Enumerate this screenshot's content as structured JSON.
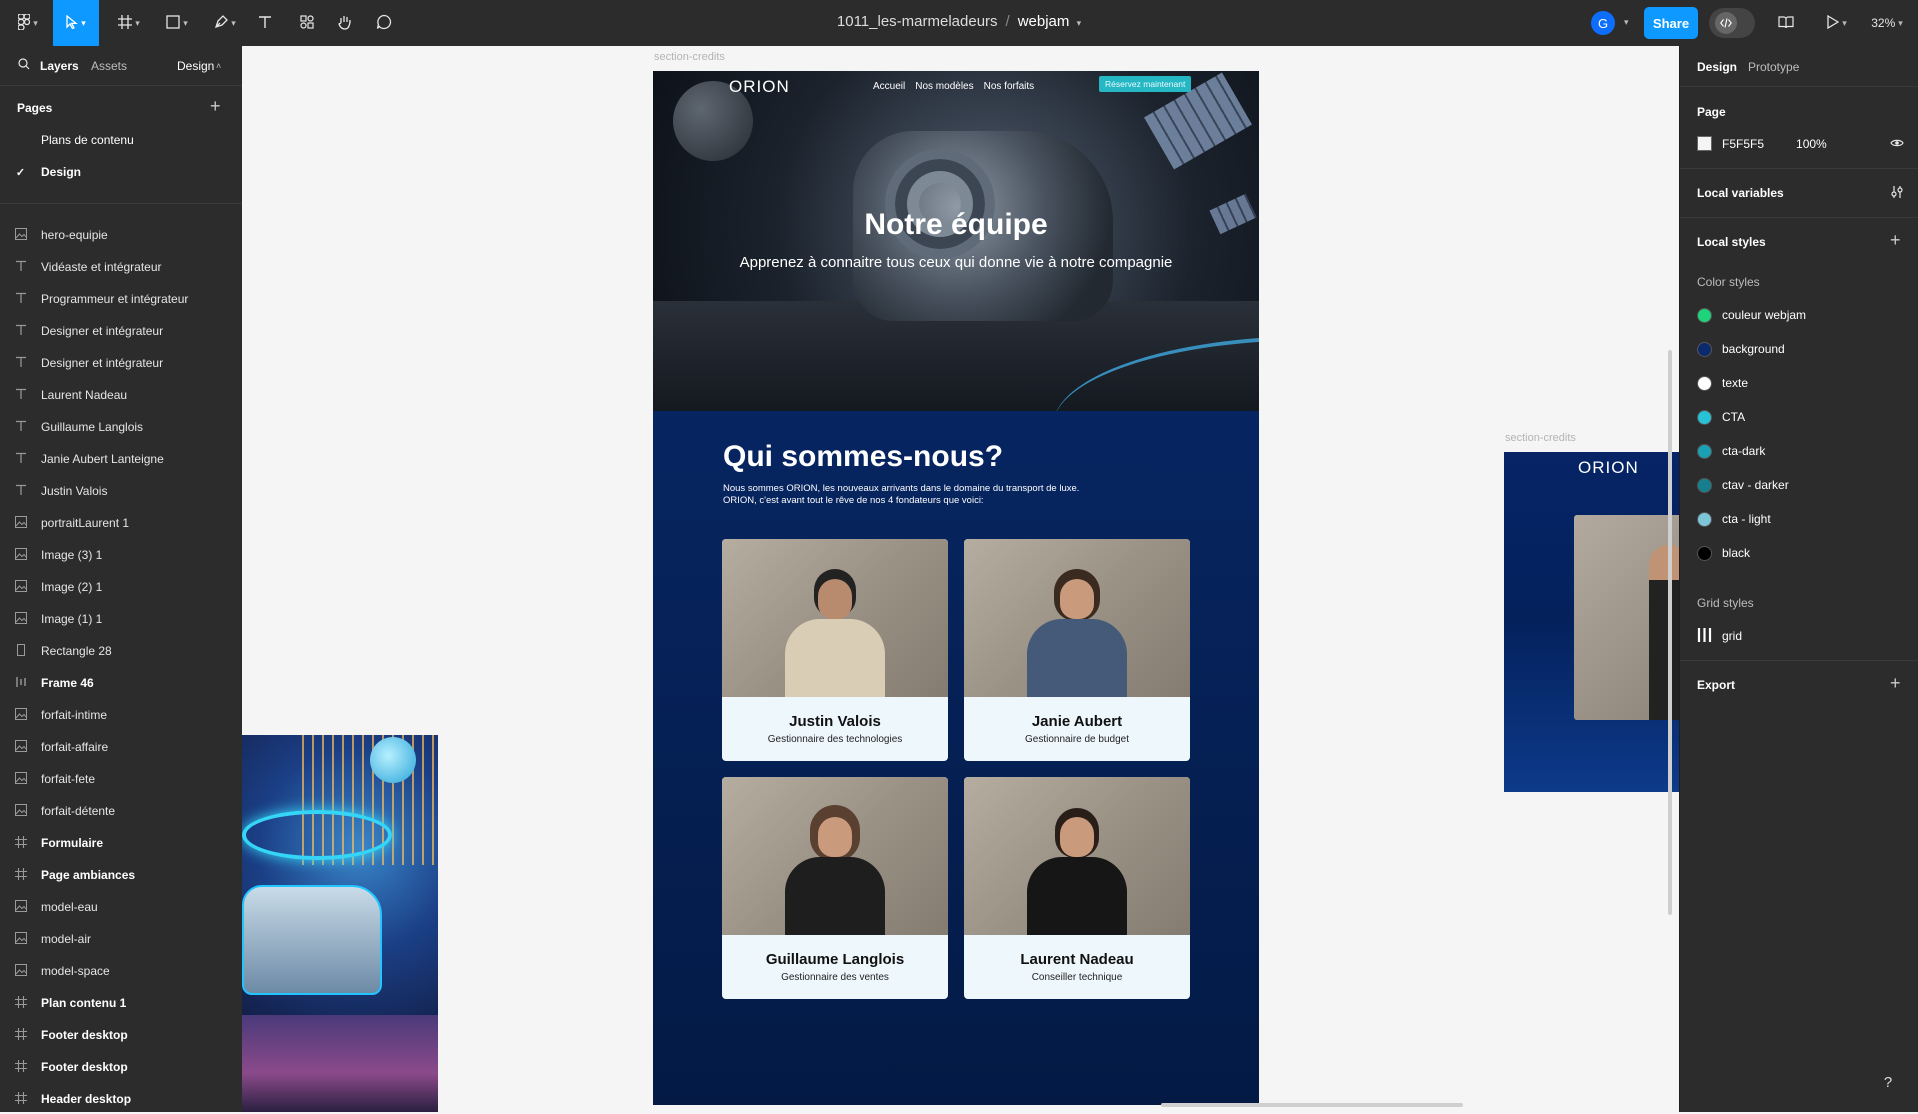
{
  "toolbar": {
    "file_name": "1011_les-marmeladeurs",
    "separator": "/",
    "project": "webjam",
    "avatar_initial": "G",
    "share_label": "Share",
    "zoom": "32%"
  },
  "left_panel": {
    "tabs": [
      "Layers",
      "Assets",
      "Design"
    ],
    "pages_heading": "Pages",
    "pages": [
      "Plans de contenu",
      "Design"
    ],
    "layers": [
      {
        "label": "hero-equipie",
        "type": "image"
      },
      {
        "label": "Vidéaste et intégrateur",
        "type": "text"
      },
      {
        "label": "Programmeur et intégrateur",
        "type": "text"
      },
      {
        "label": "Designer et intégrateur",
        "type": "text"
      },
      {
        "label": "Designer et intégrateur",
        "type": "text"
      },
      {
        "label": "Laurent Nadeau",
        "type": "text"
      },
      {
        "label": "Guillaume Langlois",
        "type": "text"
      },
      {
        "label": "Janie Aubert Lanteigne",
        "type": "text"
      },
      {
        "label": "Justin Valois",
        "type": "text"
      },
      {
        "label": "portraitLaurent 1",
        "type": "image"
      },
      {
        "label": "Image (3) 1",
        "type": "image"
      },
      {
        "label": "Image (2) 1",
        "type": "image"
      },
      {
        "label": "Image (1) 1",
        "type": "image"
      },
      {
        "label": "Rectangle 28",
        "type": "rect"
      },
      {
        "label": "Frame 46",
        "type": "autolayout"
      },
      {
        "label": "forfait-intime",
        "type": "image"
      },
      {
        "label": "forfait-affaire",
        "type": "image"
      },
      {
        "label": "forfait-fete",
        "type": "image"
      },
      {
        "label": "forfait-détente",
        "type": "image"
      },
      {
        "label": "Formulaire",
        "type": "frame"
      },
      {
        "label": "Page ambiances",
        "type": "frame"
      },
      {
        "label": "model-eau",
        "type": "image"
      },
      {
        "label": "model-air",
        "type": "image"
      },
      {
        "label": "model-space",
        "type": "image"
      },
      {
        "label": "Plan contenu 1",
        "type": "frame"
      },
      {
        "label": "Footer desktop",
        "type": "frame"
      },
      {
        "label": "Footer desktop",
        "type": "frame"
      },
      {
        "label": "Header desktop",
        "type": "frame"
      }
    ]
  },
  "right_panel": {
    "tabs": [
      "Design",
      "Prototype"
    ],
    "page_heading": "Page",
    "page_color": "F5F5F5",
    "page_opacity": "100%",
    "local_variables": "Local variables",
    "local_styles": "Local styles",
    "color_styles_heading": "Color styles",
    "color_styles": [
      {
        "name": "couleur webjam",
        "color": "#1ed47a"
      },
      {
        "name": "background",
        "color": "#0b2a6b"
      },
      {
        "name": "texte",
        "color": "#ffffff"
      },
      {
        "name": "CTA",
        "color": "#27c2d6"
      },
      {
        "name": "cta-dark",
        "color": "#1a9fb3"
      },
      {
        "name": "ctav - darker",
        "color": "#157f8e"
      },
      {
        "name": "cta - light",
        "color": "#7dc6d9"
      },
      {
        "name": "black",
        "color": "#000000"
      }
    ],
    "grid_styles_heading": "Grid styles",
    "grid_style": "grid",
    "export": "Export"
  },
  "canvas": {
    "frame_label_main": "section-credits",
    "frame_label_small": "section-credits",
    "site": {
      "logo": "ORION",
      "nav": [
        "Accueil",
        "Nos modèles",
        "Nos forfaits"
      ],
      "cta": "Réservez maintenant",
      "hero_title": "Notre équipe",
      "hero_subtitle": "Apprenez à connaitre tous ceux qui donne vie à notre compagnie",
      "about_title": "Qui sommes-nous?",
      "about_text": "Nous sommes ORION, les nouveaux arrivants dans le domaine du transport de luxe. ORION, c'est avant tout le rêve de nos 4 fondateurs que voici:",
      "team": [
        {
          "name": "Justin Valois",
          "role": "Gestionnaire des technologies"
        },
        {
          "name": "Janie Aubert",
          "role": "Gestionnaire de budget"
        },
        {
          "name": "Guillaume Langlois",
          "role": "Gestionnaire des ventes"
        },
        {
          "name": "Laurent Nadeau",
          "role": "Conseiller technique"
        }
      ]
    },
    "small_frame_logo": "ORION"
  },
  "help": "?"
}
